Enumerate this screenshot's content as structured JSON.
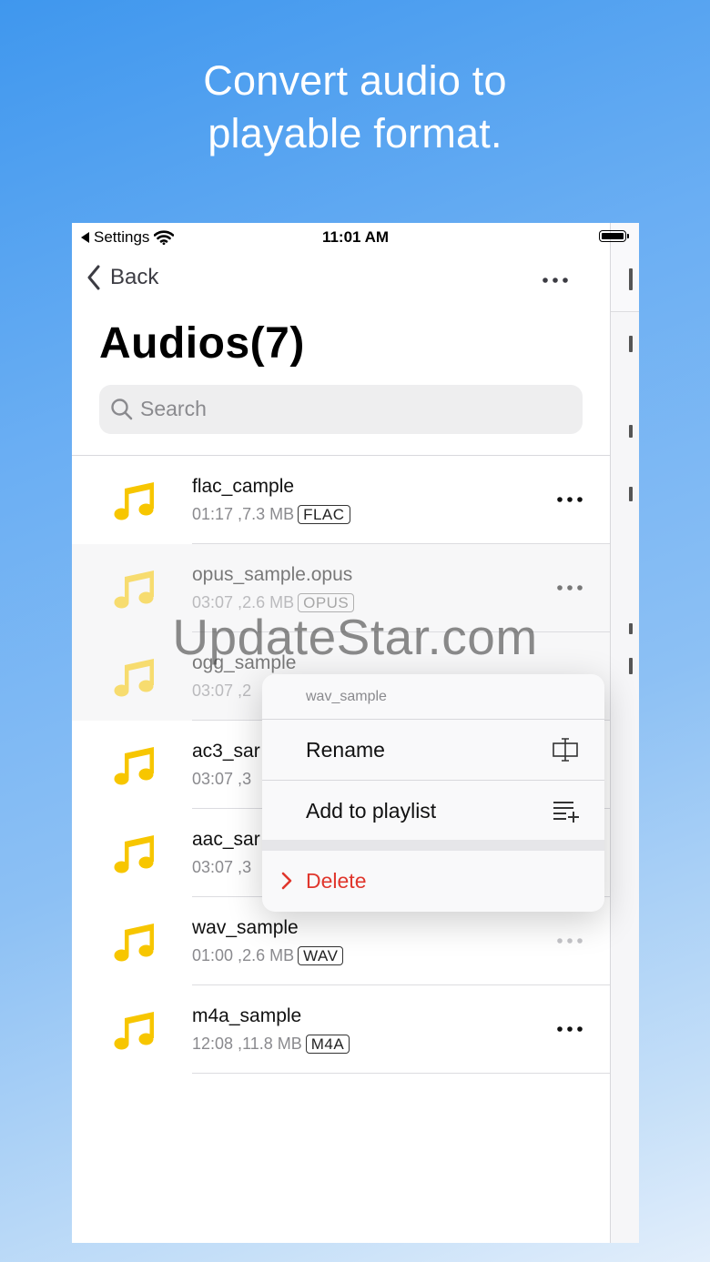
{
  "headline": {
    "line1": "Convert audio to",
    "line2": "playable format."
  },
  "statusbar": {
    "back_app": "Settings",
    "time": "11:01 AM"
  },
  "navbar": {
    "back_label": "Back"
  },
  "page": {
    "title": "Audios(7)"
  },
  "search": {
    "placeholder": "Search"
  },
  "files": [
    {
      "name": "flac_cample",
      "duration": "01:17",
      "size": "7.3 MB",
      "format": "FLAC"
    },
    {
      "name": "opus_sample.opus",
      "duration": "03:07",
      "size": "2.6 MB",
      "format": "OPUS"
    },
    {
      "name": "ogg_sample",
      "duration": "03:07",
      "size": "2"
    },
    {
      "name": "ac3_sar",
      "duration": "03:07",
      "size": "3"
    },
    {
      "name": "aac_sar",
      "duration": "03:07",
      "size": "3"
    },
    {
      "name": "wav_sample",
      "duration": "01:00",
      "size": "2.6 MB",
      "format": "WAV"
    },
    {
      "name": "m4a_sample",
      "duration": "12:08",
      "size": "11.8 MB",
      "format": "M4A"
    }
  ],
  "context_menu": {
    "header": "wav_sample",
    "rename_label": "Rename",
    "add_to_playlist_label": "Add to playlist",
    "delete_label": "Delete"
  },
  "watermark": "UpdateStar.com",
  "colors": {
    "note": "#f7c600",
    "delete": "#e0362c"
  }
}
